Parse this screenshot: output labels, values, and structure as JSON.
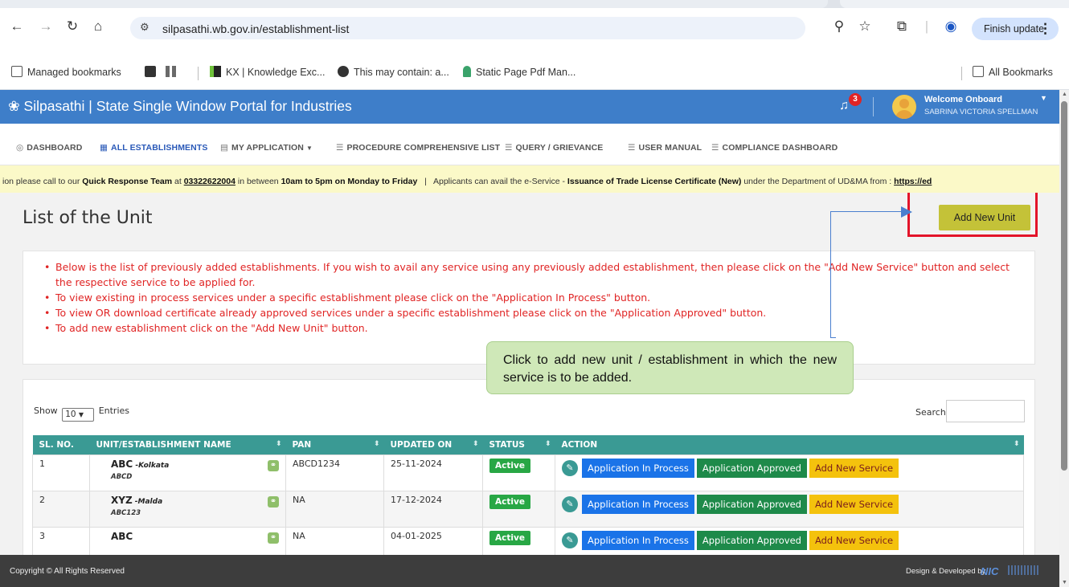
{
  "browser": {
    "url": "silpasathi.wb.gov.in/establishment-list",
    "finish_update": "Finish update",
    "bookmarks": [
      "Managed bookmarks",
      "KX | Knowledge Exc...",
      "This may contain: a...",
      "Static Page Pdf Man..."
    ],
    "all_bookmarks": "All Bookmarks"
  },
  "header": {
    "title": "Silpasathi | State Single Window Portal for Industries",
    "notification_count": "3",
    "welcome": "Welcome Onboard",
    "user_name": "SABRINA VICTORIA SPELLMAN",
    "color": "#3e7ec9"
  },
  "nav": {
    "items": [
      "DASHBOARD",
      "ALL ESTABLISHMENTS",
      "MY APPLICATION",
      "PROCEDURE COMPREHENSIVE LIST",
      "QUERY / GRIEVANCE",
      "USER MANUAL",
      "COMPLIANCE DASHBOARD"
    ],
    "active": "ALL ESTABLISHMENTS"
  },
  "ticker": {
    "t1": "ion please call to our ",
    "team": "Quick Response Team",
    "t2": " at ",
    "phone": "03322622004",
    "t3": " in between ",
    "hours": "10am to 5pm on Monday to Friday",
    "t4": "   |   Applicants can avail the e-Service - ",
    "service": "Issuance of Trade License Certificate (New)",
    "t5": " under the Department of UD&MA from : ",
    "link": "https://ed"
  },
  "page": {
    "title": "List of the Unit",
    "add_unit_label": "Add New Unit",
    "instructions": [
      "Below is the list of previously added establishments. If you wish to avail any service using any previously added establishment, then please click on the \"Add New Service\" button and select the respective service to be applied for.",
      "To view existing in process services under a specific establishment please click on the \"Application In Process\" button.",
      "To view OR download certificate already approved services under a specific establishment please click on the \"Application Approved\" button.",
      "To add new establishment click on the \"Add New Unit\" button."
    ]
  },
  "table": {
    "show": "Show",
    "entries_value": "10",
    "entries": "Entries",
    "search": "Search:",
    "columns": [
      "SL. NO.",
      "UNIT/ESTABLISHMENT NAME",
      "PAN",
      "UPDATED ON",
      "STATUS",
      "ACTION"
    ],
    "rows": [
      {
        "sl": "1",
        "name": "ABC",
        "loc": " -Kolkata",
        "sub": "ABCD",
        "pan": "ABCD1234",
        "updated": "25-11-2024",
        "status": "Active"
      },
      {
        "sl": "2",
        "name": "XYZ",
        "loc": " -Malda",
        "sub": "ABC123",
        "pan": "NA",
        "updated": "17-12-2024",
        "status": "Active"
      },
      {
        "sl": "3",
        "name": "ABC",
        "loc": "",
        "sub": "",
        "pan": "NA",
        "updated": "04-01-2025",
        "status": "Active"
      }
    ],
    "actions": {
      "in_process": "Application In Process",
      "approved": "Application Approved",
      "add_service": "Add New Service"
    }
  },
  "callout": {
    "text": "Click to add new unit / establishment in which the new service is to be added."
  },
  "footer": {
    "copyright": "Copyright © All Rights Reserved",
    "designed": "Design & Developed by",
    "nic": "NIC"
  }
}
